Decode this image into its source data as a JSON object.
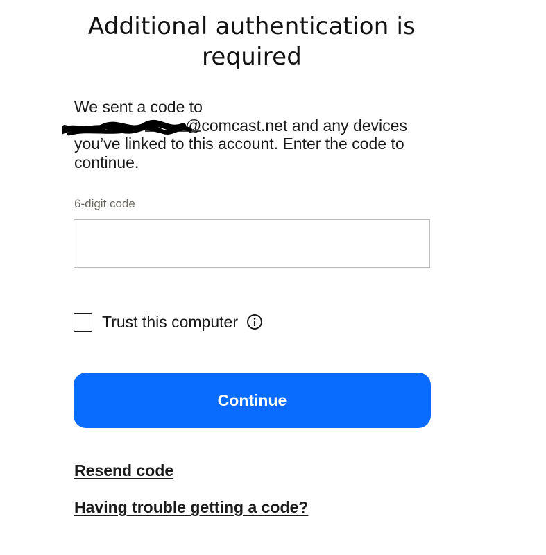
{
  "header": {
    "title": "Additional authentication is required"
  },
  "instructions": {
    "prefix": "We sent a code to",
    "email_visible": "@comcast.net",
    "suffix": " and any devices you’ve linked to this account. Enter the code to continue."
  },
  "form": {
    "code_label": "6-digit code",
    "code_value": "",
    "code_placeholder": "",
    "trust_checked": false,
    "trust_label": "Trust this computer"
  },
  "actions": {
    "continue_label": "Continue",
    "resend_label": "Resend code",
    "trouble_label": "Having trouble getting a code?"
  },
  "icons": {
    "info": "info-circle-icon",
    "redaction": "scribble-redaction"
  },
  "colors": {
    "primary_button": "#0a6cff",
    "label_muted": "#6b6760",
    "text": "#1a1a1a",
    "input_border": "#bdbdbd"
  }
}
